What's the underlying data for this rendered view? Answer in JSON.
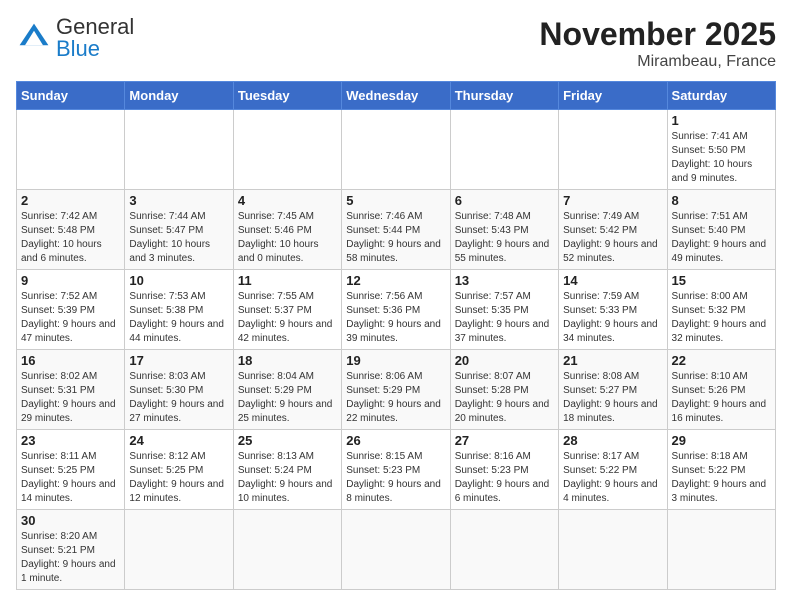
{
  "header": {
    "logo_general": "General",
    "logo_blue": "Blue",
    "month_year": "November 2025",
    "location": "Mirambeau, France"
  },
  "weekdays": [
    "Sunday",
    "Monday",
    "Tuesday",
    "Wednesday",
    "Thursday",
    "Friday",
    "Saturday"
  ],
  "weeks": [
    [
      {
        "day": "",
        "info": ""
      },
      {
        "day": "",
        "info": ""
      },
      {
        "day": "",
        "info": ""
      },
      {
        "day": "",
        "info": ""
      },
      {
        "day": "",
        "info": ""
      },
      {
        "day": "",
        "info": ""
      },
      {
        "day": "1",
        "info": "Sunrise: 7:41 AM\nSunset: 5:50 PM\nDaylight: 10 hours and 9 minutes."
      }
    ],
    [
      {
        "day": "2",
        "info": "Sunrise: 7:42 AM\nSunset: 5:48 PM\nDaylight: 10 hours and 6 minutes."
      },
      {
        "day": "3",
        "info": "Sunrise: 7:44 AM\nSunset: 5:47 PM\nDaylight: 10 hours and 3 minutes."
      },
      {
        "day": "4",
        "info": "Sunrise: 7:45 AM\nSunset: 5:46 PM\nDaylight: 10 hours and 0 minutes."
      },
      {
        "day": "5",
        "info": "Sunrise: 7:46 AM\nSunset: 5:44 PM\nDaylight: 9 hours and 58 minutes."
      },
      {
        "day": "6",
        "info": "Sunrise: 7:48 AM\nSunset: 5:43 PM\nDaylight: 9 hours and 55 minutes."
      },
      {
        "day": "7",
        "info": "Sunrise: 7:49 AM\nSunset: 5:42 PM\nDaylight: 9 hours and 52 minutes."
      },
      {
        "day": "8",
        "info": "Sunrise: 7:51 AM\nSunset: 5:40 PM\nDaylight: 9 hours and 49 minutes."
      }
    ],
    [
      {
        "day": "9",
        "info": "Sunrise: 7:52 AM\nSunset: 5:39 PM\nDaylight: 9 hours and 47 minutes."
      },
      {
        "day": "10",
        "info": "Sunrise: 7:53 AM\nSunset: 5:38 PM\nDaylight: 9 hours and 44 minutes."
      },
      {
        "day": "11",
        "info": "Sunrise: 7:55 AM\nSunset: 5:37 PM\nDaylight: 9 hours and 42 minutes."
      },
      {
        "day": "12",
        "info": "Sunrise: 7:56 AM\nSunset: 5:36 PM\nDaylight: 9 hours and 39 minutes."
      },
      {
        "day": "13",
        "info": "Sunrise: 7:57 AM\nSunset: 5:35 PM\nDaylight: 9 hours and 37 minutes."
      },
      {
        "day": "14",
        "info": "Sunrise: 7:59 AM\nSunset: 5:33 PM\nDaylight: 9 hours and 34 minutes."
      },
      {
        "day": "15",
        "info": "Sunrise: 8:00 AM\nSunset: 5:32 PM\nDaylight: 9 hours and 32 minutes."
      }
    ],
    [
      {
        "day": "16",
        "info": "Sunrise: 8:02 AM\nSunset: 5:31 PM\nDaylight: 9 hours and 29 minutes."
      },
      {
        "day": "17",
        "info": "Sunrise: 8:03 AM\nSunset: 5:30 PM\nDaylight: 9 hours and 27 minutes."
      },
      {
        "day": "18",
        "info": "Sunrise: 8:04 AM\nSunset: 5:29 PM\nDaylight: 9 hours and 25 minutes."
      },
      {
        "day": "19",
        "info": "Sunrise: 8:06 AM\nSunset: 5:29 PM\nDaylight: 9 hours and 22 minutes."
      },
      {
        "day": "20",
        "info": "Sunrise: 8:07 AM\nSunset: 5:28 PM\nDaylight: 9 hours and 20 minutes."
      },
      {
        "day": "21",
        "info": "Sunrise: 8:08 AM\nSunset: 5:27 PM\nDaylight: 9 hours and 18 minutes."
      },
      {
        "day": "22",
        "info": "Sunrise: 8:10 AM\nSunset: 5:26 PM\nDaylight: 9 hours and 16 minutes."
      }
    ],
    [
      {
        "day": "23",
        "info": "Sunrise: 8:11 AM\nSunset: 5:25 PM\nDaylight: 9 hours and 14 minutes."
      },
      {
        "day": "24",
        "info": "Sunrise: 8:12 AM\nSunset: 5:25 PM\nDaylight: 9 hours and 12 minutes."
      },
      {
        "day": "25",
        "info": "Sunrise: 8:13 AM\nSunset: 5:24 PM\nDaylight: 9 hours and 10 minutes."
      },
      {
        "day": "26",
        "info": "Sunrise: 8:15 AM\nSunset: 5:23 PM\nDaylight: 9 hours and 8 minutes."
      },
      {
        "day": "27",
        "info": "Sunrise: 8:16 AM\nSunset: 5:23 PM\nDaylight: 9 hours and 6 minutes."
      },
      {
        "day": "28",
        "info": "Sunrise: 8:17 AM\nSunset: 5:22 PM\nDaylight: 9 hours and 4 minutes."
      },
      {
        "day": "29",
        "info": "Sunrise: 8:18 AM\nSunset: 5:22 PM\nDaylight: 9 hours and 3 minutes."
      }
    ],
    [
      {
        "day": "30",
        "info": "Sunrise: 8:20 AM\nSunset: 5:21 PM\nDaylight: 9 hours and 1 minute."
      },
      {
        "day": "",
        "info": ""
      },
      {
        "day": "",
        "info": ""
      },
      {
        "day": "",
        "info": ""
      },
      {
        "day": "",
        "info": ""
      },
      {
        "day": "",
        "info": ""
      },
      {
        "day": "",
        "info": ""
      }
    ]
  ]
}
